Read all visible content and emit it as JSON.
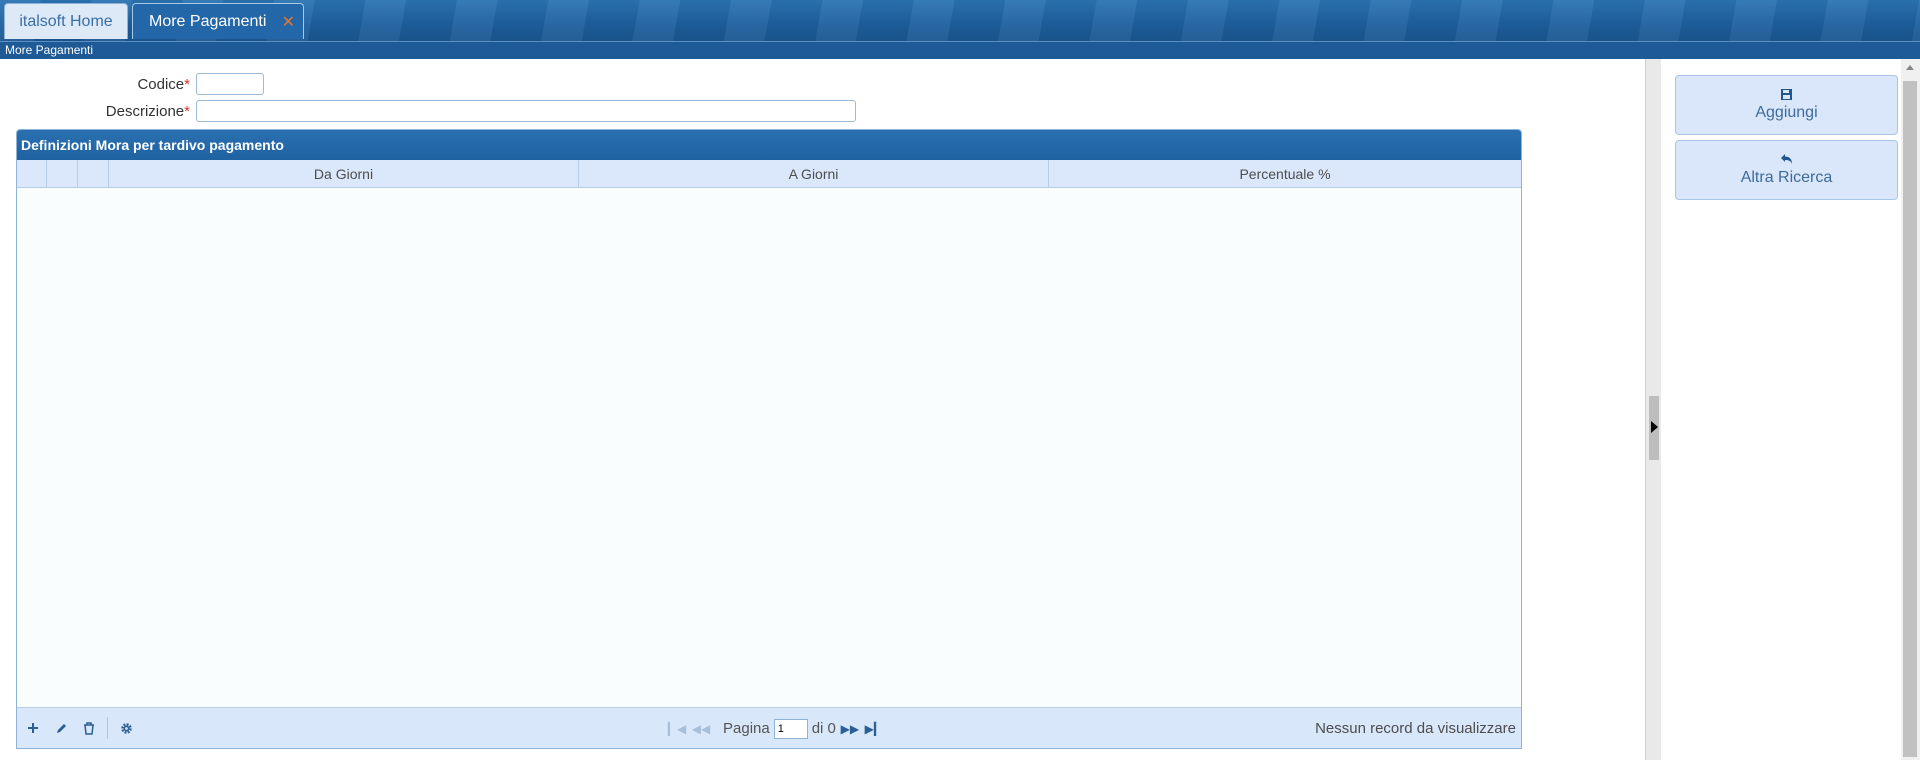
{
  "tabs": [
    {
      "label": "italsoft Home"
    },
    {
      "label": "More Pagamenti"
    }
  ],
  "close_glyph": "✕",
  "breadcrumb": "More Pagamenti",
  "form": {
    "codice_label": "Codice",
    "codice_value": "",
    "descrizione_label": "Descrizione",
    "descrizione_value": "",
    "required_mark": "*"
  },
  "grid": {
    "caption": "Definizioni Mora per tardivo pagamento",
    "columns": [
      "Da Giorni",
      "A Giorni",
      "Percentuale %"
    ],
    "rows": [],
    "pager": {
      "page_label": "Pagina",
      "page_value": "1",
      "of_label": "di 0"
    },
    "empty_message": "Nessun record da visualizzare"
  },
  "side_buttons": [
    {
      "label": "Aggiungi",
      "icon": "floppy-disk-icon"
    },
    {
      "label": "Altra Ricerca",
      "icon": "undo-arrow-icon"
    }
  ],
  "colors": {
    "header_blue": "#1f62a2",
    "light_blue": "#dbe8fb",
    "close_orange": "#e8762a",
    "required_red": "#d9342b"
  }
}
